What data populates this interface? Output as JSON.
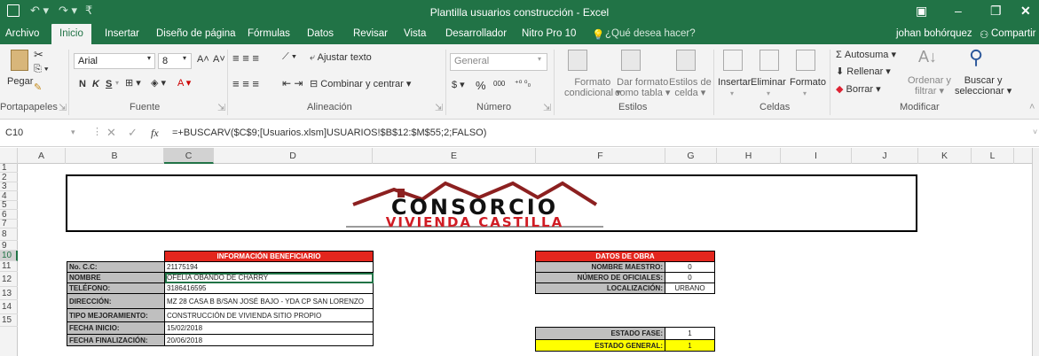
{
  "window": {
    "title": "Plantilla usuarios construcción - Excel",
    "user": "johan bohórquez",
    "share": "Compartir"
  },
  "tabs": [
    "Archivo",
    "Inicio",
    "Insertar",
    "Diseño de página",
    "Fórmulas",
    "Datos",
    "Revisar",
    "Vista",
    "Desarrollador",
    "Nitro Pro 10"
  ],
  "help_prompt": "¿Qué desea hacer?",
  "ribbon": {
    "clipboard": {
      "paste": "Pegar",
      "group": "Portapapeles"
    },
    "font": {
      "name": "Arial",
      "size": "8",
      "bold": "N",
      "italic": "K",
      "underline": "S",
      "group": "Fuente"
    },
    "alignment": {
      "wrap": "Ajustar texto",
      "merge": "Combinar y centrar",
      "group": "Alineación"
    },
    "number": {
      "format": "General",
      "currency": "$",
      "percent": "%",
      "thousands": "000",
      "group": "Número"
    },
    "styles": {
      "conditional1": "Formato",
      "conditional2": "condicional",
      "table1": "Dar formato",
      "table2": "como tabla",
      "cell1": "Estilos de",
      "cell2": "celda",
      "group": "Estilos"
    },
    "cells": {
      "insert": "Insertar",
      "delete": "Eliminar",
      "format": "Formato",
      "group": "Celdas"
    },
    "editing": {
      "autosum": "Autosuma",
      "fill": "Rellenar",
      "clear": "Borrar",
      "sort1": "Ordenar y",
      "sort2": "filtrar",
      "find1": "Buscar y",
      "find2": "seleccionar",
      "group": "Modificar"
    }
  },
  "formula_bar": {
    "name_box": "C10",
    "fx": "fx",
    "formula": "=+BUSCARV($C$9;[Usuarios.xlsm]USUARIOS!$B$12:$M$55;2;FALSO)"
  },
  "columns": [
    "A",
    "B",
    "C",
    "D",
    "E",
    "F",
    "G",
    "H",
    "I",
    "J",
    "K",
    "L"
  ],
  "rows": [
    "1",
    "2",
    "3",
    "4",
    "5",
    "6",
    "7",
    "8",
    "9",
    "10",
    "11",
    "12",
    "13",
    "14",
    "15"
  ],
  "logo": {
    "line1": "CONSORCIO",
    "line2": "VIVIENDA CASTILLA"
  },
  "beneficiary": {
    "header": "INFORMACIÓN BENEFICIARIO",
    "fields": [
      {
        "label": "No. C.C:",
        "value": "21175194"
      },
      {
        "label": "NOMBRE",
        "value": "OFELIA OBANDO DE CHARRY"
      },
      {
        "label": "TELÉFONO:",
        "value": "3186416595"
      },
      {
        "label": "DIRECCIÓN:",
        "value": "MZ 28 CASA B B/SAN JOSÉ BAJO - YDA CP SAN LORENZO"
      },
      {
        "label": "TIPO MEJORAMIENTO:",
        "value": "CONSTRUCCIÓN DE VIVIENDA SITIO PROPIO"
      },
      {
        "label": "FECHA INICIO:",
        "value": "15/02/2018"
      },
      {
        "label": "FECHA FINALIZACIÓN:",
        "value": "20/06/2018"
      }
    ]
  },
  "work": {
    "header": "DATOS DE OBRA",
    "fields": [
      {
        "label": "NOMBRE MAESTRO:",
        "value": "0"
      },
      {
        "label": "NÚMERO DE OFICIALES:",
        "value": "0"
      },
      {
        "label": "LOCALIZACIÓN:",
        "value": "URBANO"
      }
    ],
    "phase_label": "ESTADO FASE:",
    "phase_value": "1",
    "general_label": "ESTADO GENERAL:",
    "general_value": "1"
  },
  "colors": {
    "excel_green": "#217346",
    "header_red": "#e3261e",
    "label_gray": "#bfbfbf",
    "highlight_yellow": "#ffff00"
  }
}
